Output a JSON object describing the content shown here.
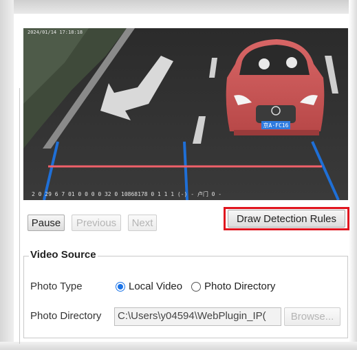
{
  "video": {
    "osd_top": "2024/01/14 17:18:18",
    "osd_bottom": "2 0 29 6 7 01 0 0 0 0 32 0 10868178 0 1 1 1 (-) - 卢门 0 -",
    "plate": "京A·FC16"
  },
  "controls": {
    "pause_label": "Pause",
    "previous_label": "Previous",
    "next_label": "Next",
    "draw_rules_label": "Draw Detection Rules"
  },
  "video_source": {
    "legend": "Video Source",
    "photo_type_label": "Photo Type",
    "options": [
      {
        "label": "Local Video",
        "selected": true
      },
      {
        "label": "Photo Directory",
        "selected": false
      }
    ],
    "photo_directory_label": "Photo Directory",
    "photo_directory_value": "C:\\Users\\y04594\\WebPlugin_IP(",
    "browse_label": "Browse..."
  },
  "colors": {
    "accent": "#1a73e8",
    "highlight": "#e0141e",
    "detection_line": "#f0606a",
    "lane_line": "#1f6fd6"
  }
}
